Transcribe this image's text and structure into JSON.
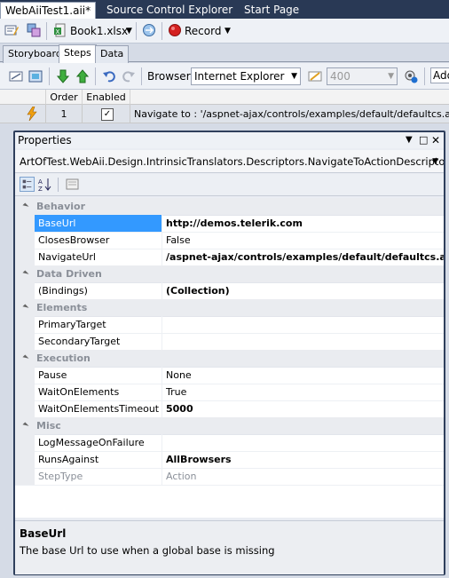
{
  "doc_tabs": [
    "WebAiiTest1.aii*",
    "Source Control Explorer",
    "Start Page"
  ],
  "toolbar": {
    "datasource": "Book1.xlsx",
    "record": "Record"
  },
  "view_tabs": [
    "Storyboard",
    "Steps",
    "Data"
  ],
  "steps_toolbar": {
    "browser_label": "Browser:",
    "browser_value": "Internet Explorer",
    "delay_value": "400",
    "add_label": "Add"
  },
  "grid": {
    "columns": [
      "Order",
      "Enabled"
    ],
    "row": {
      "order": "1",
      "checked": "✓",
      "description": "Navigate to : '/aspnet-ajax/controls/examples/default/defaultcs.aspx'"
    }
  },
  "properties": {
    "title": "Properties",
    "object": "ArtOfTest.WebAii.Design.IntrinsicTranslators.Descriptors.NavigateToActionDescriptor",
    "categories": [
      {
        "name": "Behavior",
        "rows": [
          {
            "name": "BaseUrl",
            "value": "http://demos.telerik.com",
            "bold": true,
            "selected": true
          },
          {
            "name": "ClosesBrowser",
            "value": "False"
          },
          {
            "name": "NavigateUrl",
            "value": "/aspnet-ajax/controls/examples/default/defaultcs.aspx",
            "bold": true
          }
        ]
      },
      {
        "name": "Data Driven",
        "rows": [
          {
            "name": "(Bindings)",
            "value": "(Collection)",
            "bold": true
          }
        ]
      },
      {
        "name": "Elements",
        "rows": [
          {
            "name": "PrimaryTarget",
            "value": ""
          },
          {
            "name": "SecondaryTarget",
            "value": ""
          }
        ]
      },
      {
        "name": "Execution",
        "rows": [
          {
            "name": "Pause",
            "value": "None"
          },
          {
            "name": "WaitOnElements",
            "value": "True"
          },
          {
            "name": "WaitOnElementsTimeout",
            "value": "5000",
            "bold": true
          }
        ]
      },
      {
        "name": "Misc",
        "rows": [
          {
            "name": "LogMessageOnFailure",
            "value": ""
          },
          {
            "name": "RunsAgainst",
            "value": "AllBrowsers",
            "bold": true
          },
          {
            "name": "StepType",
            "value": "Action",
            "grey": true
          }
        ]
      }
    ],
    "description_title": "BaseUrl",
    "description_text": "The base Url to use when a global base is missing"
  },
  "colors": {
    "selection": "#3399ff",
    "doc_tab_bar": "#293955",
    "panel_border": "#2f3f5c"
  }
}
